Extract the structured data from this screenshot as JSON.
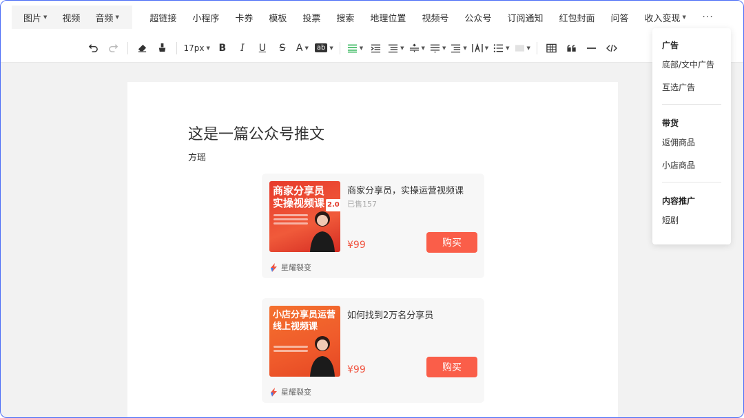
{
  "menubar": {
    "items": [
      {
        "label": "图片",
        "caret": true
      },
      {
        "label": "视频",
        "caret": false
      },
      {
        "label": "音频",
        "caret": true
      }
    ],
    "right_items": [
      {
        "label": "超链接"
      },
      {
        "label": "小程序"
      },
      {
        "label": "卡券"
      },
      {
        "label": "模板"
      },
      {
        "label": "投票"
      },
      {
        "label": "搜索"
      },
      {
        "label": "地理位置"
      },
      {
        "label": "视频号"
      },
      {
        "label": "公众号"
      },
      {
        "label": "订阅通知"
      },
      {
        "label": "红包封面"
      },
      {
        "label": "问答"
      },
      {
        "label": "收入变现",
        "caret": true
      }
    ],
    "more_label": "···"
  },
  "toolbar": {
    "font_size": "17px",
    "bold": "B",
    "italic": "I",
    "underline": "U",
    "strike": "S",
    "font_color": "A",
    "highlight": "ab"
  },
  "article": {
    "title": "这是一篇公众号推文",
    "author": "方瑶"
  },
  "products": [
    {
      "thumb_title_line1": "商家分享员",
      "thumb_title_line2": "实操视频课",
      "thumb_badge": "2.0",
      "name": "商家分享员，实操运营视频课",
      "sold": "已售157",
      "price": "¥99",
      "buy_label": "购买",
      "shop": "星耀裂变"
    },
    {
      "thumb_title_line1": "小店分享员运营",
      "thumb_title_line2": "线上视频课",
      "thumb_badge": "",
      "name": "如何找到2万名分享员",
      "sold": "",
      "price": "¥99",
      "buy_label": "购买",
      "shop": "星耀裂变"
    }
  ],
  "dropdown": {
    "sections": [
      {
        "heading": "广告",
        "items": [
          "底部/文中广告",
          "互选广告"
        ]
      },
      {
        "heading": "带货",
        "items": [
          "返佣商品",
          "小店商品"
        ]
      },
      {
        "heading": "内容推广",
        "items": [
          "短剧"
        ]
      }
    ]
  },
  "colors": {
    "accent_green": "#23b04d",
    "buy_button": "#fa5e49",
    "price": "#f0533f",
    "frame_border": "#4a6cf7"
  }
}
